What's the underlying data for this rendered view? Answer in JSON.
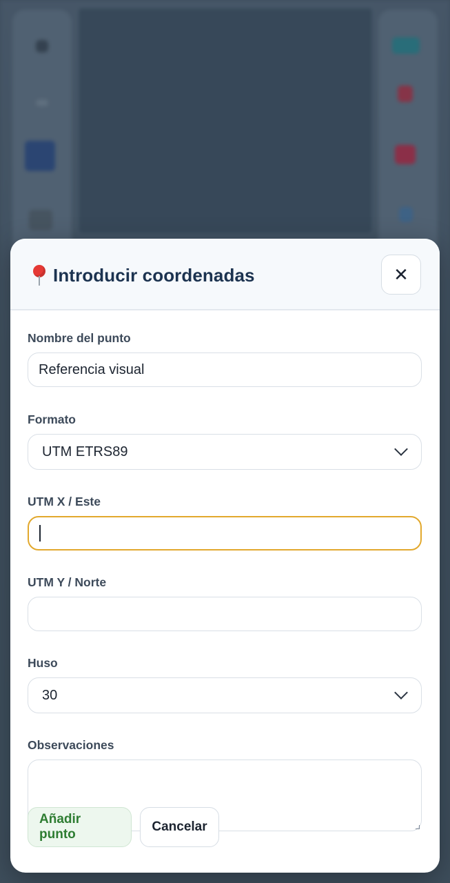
{
  "dialog": {
    "title": "Introducir coordenadas",
    "close_label": "✕"
  },
  "form": {
    "name": {
      "label": "Nombre del punto",
      "value": "Referencia visual"
    },
    "format": {
      "label": "Formato",
      "selected": "UTM ETRS89"
    },
    "utm_x": {
      "label": "UTM X / Este",
      "value": ""
    },
    "utm_y": {
      "label": "UTM Y / Norte",
      "value": ""
    },
    "zone": {
      "label": "Huso",
      "selected": "30"
    },
    "notes": {
      "label": "Observaciones",
      "value": ""
    }
  },
  "actions": {
    "add_label": "Añadir punto",
    "cancel_label": "Cancelar"
  },
  "colors": {
    "accent_focus": "#e2a82c",
    "primary_text": "#1c3350",
    "add_button_text": "#2e7d32",
    "add_button_bg": "#edf7ee",
    "pin": "#e53935"
  }
}
